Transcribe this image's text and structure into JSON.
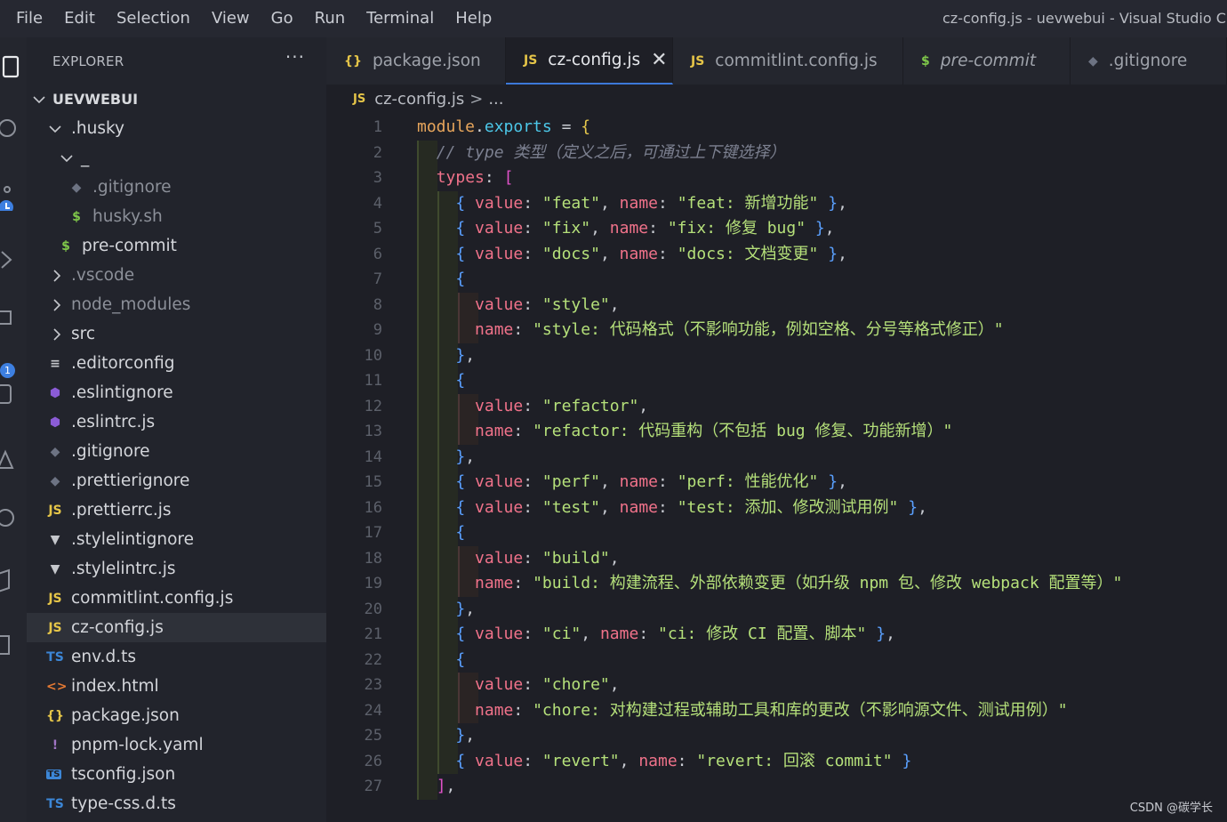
{
  "menu": [
    "File",
    "Edit",
    "Selection",
    "View",
    "Go",
    "Run",
    "Terminal",
    "Help"
  ],
  "window_title": "cz-config.js - uevwebui - Visual Studio C",
  "activity_badge": "1",
  "explorer": {
    "title": "EXPLORER",
    "more": "···",
    "root": "UEVWEBUI",
    "items": [
      {
        "label": ".husky",
        "icon": "chevron-down",
        "type": "folder-open"
      },
      {
        "label": "_",
        "icon": "chevron-down",
        "type": "folder-open"
      },
      {
        "label": ".gitignore",
        "icon": "git-icon",
        "type": "file"
      },
      {
        "label": "husky.sh",
        "icon": "dollar-icon",
        "type": "file"
      },
      {
        "label": "pre-commit",
        "icon": "dollar-icon",
        "type": "file"
      },
      {
        "label": ".vscode",
        "icon": "chevron-right",
        "type": "folder"
      },
      {
        "label": "node_modules",
        "icon": "chevron-right",
        "type": "folder"
      },
      {
        "label": "src",
        "icon": "chevron-right",
        "type": "folder"
      },
      {
        "label": ".editorconfig",
        "icon": "lines-icon",
        "type": "file"
      },
      {
        "label": ".eslintignore",
        "icon": "eslint-icon",
        "type": "file"
      },
      {
        "label": ".eslintrc.js",
        "icon": "eslint-icon",
        "type": "file"
      },
      {
        "label": ".gitignore",
        "icon": "git-icon",
        "type": "file"
      },
      {
        "label": ".prettierignore",
        "icon": "git-icon",
        "type": "file"
      },
      {
        "label": ".prettierrc.js",
        "icon": "js-icon",
        "type": "file"
      },
      {
        "label": ".stylelintignore",
        "icon": "stylelint-icon",
        "type": "file"
      },
      {
        "label": ".stylelintrc.js",
        "icon": "stylelint-icon",
        "type": "file"
      },
      {
        "label": "commitlint.config.js",
        "icon": "js-icon",
        "type": "file"
      },
      {
        "label": "cz-config.js",
        "icon": "js-icon",
        "type": "file"
      },
      {
        "label": "env.d.ts",
        "icon": "ts-icon",
        "type": "file"
      },
      {
        "label": "index.html",
        "icon": "html-icon",
        "type": "file"
      },
      {
        "label": "package.json",
        "icon": "json-icon",
        "type": "file"
      },
      {
        "label": "pnpm-lock.yaml",
        "icon": "yaml-icon",
        "type": "file"
      },
      {
        "label": "tsconfig.json",
        "icon": "tsconfig-icon",
        "type": "file"
      },
      {
        "label": "type-css.d.ts",
        "icon": "ts-icon",
        "type": "file"
      }
    ]
  },
  "icon_glyphs": {
    "js": "JS",
    "ts": "TS",
    "json": "{}",
    "dollar": "$",
    "html": "<>",
    "yaml": "!",
    "tsconfig": "TS",
    "lines": "≡",
    "git": "◆",
    "eslint": "⬢",
    "stylelint": "▼"
  },
  "tabs": [
    {
      "label": "package.json",
      "icon": "{}",
      "active": false,
      "italic": false
    },
    {
      "label": "cz-config.js",
      "icon": "JS",
      "active": true,
      "italic": false,
      "close": "✕"
    },
    {
      "label": "commitlint.config.js",
      "icon": "JS",
      "active": false,
      "italic": false
    },
    {
      "label": "pre-commit",
      "icon": "$",
      "active": false,
      "italic": true
    },
    {
      "label": ".gitignore",
      "icon": "◆",
      "active": false,
      "italic": false
    }
  ],
  "breadcrumb": {
    "icon": "JS",
    "file": "cz-config.js",
    "sep": ">",
    "rest": "..."
  },
  "code_lines": [
    "module.exports = {",
    "  // type 类型（定义之后，可通过上下键选择）",
    "  types: [",
    "    { value: \"feat\", name: \"feat: 新增功能\" },",
    "    { value: \"fix\", name: \"fix: 修复 bug\" },",
    "    { value: \"docs\", name: \"docs: 文档变更\" },",
    "    {",
    "      value: \"style\",",
    "      name: \"style: 代码格式（不影响功能，例如空格、分号等格式修正）\"",
    "    },",
    "    {",
    "      value: \"refactor\",",
    "      name: \"refactor: 代码重构（不包括 bug 修复、功能新增）\"",
    "    },",
    "    { value: \"perf\", name: \"perf: 性能优化\" },",
    "    { value: \"test\", name: \"test: 添加、修改测试用例\" },",
    "    {",
    "      value: \"build\",",
    "      name: \"build: 构建流程、外部依赖变更（如升级 npm 包、修改 webpack 配置等）\"",
    "    },",
    "    { value: \"ci\", name: \"ci: 修改 CI 配置、脚本\" },",
    "    {",
    "      value: \"chore\",",
    "      name: \"chore: 对构建过程或辅助工具和库的更改（不影响源文件、测试用例）\"",
    "    },",
    "    { value: \"revert\", name: \"revert: 回滚 commit\" }",
    "  ],"
  ],
  "colors": {
    "js": "#e5c548",
    "ts": "#3c86d6",
    "json": "#e5c548",
    "dollar": "#7fc74a",
    "html": "#e37933",
    "yaml": "#a074c4",
    "git": "#6d7383",
    "eslint": "#8b5cd6",
    "stylelint": "#c5c7cc",
    "lines": "#c5c7cc"
  },
  "watermark": "CSDN @碳学长"
}
